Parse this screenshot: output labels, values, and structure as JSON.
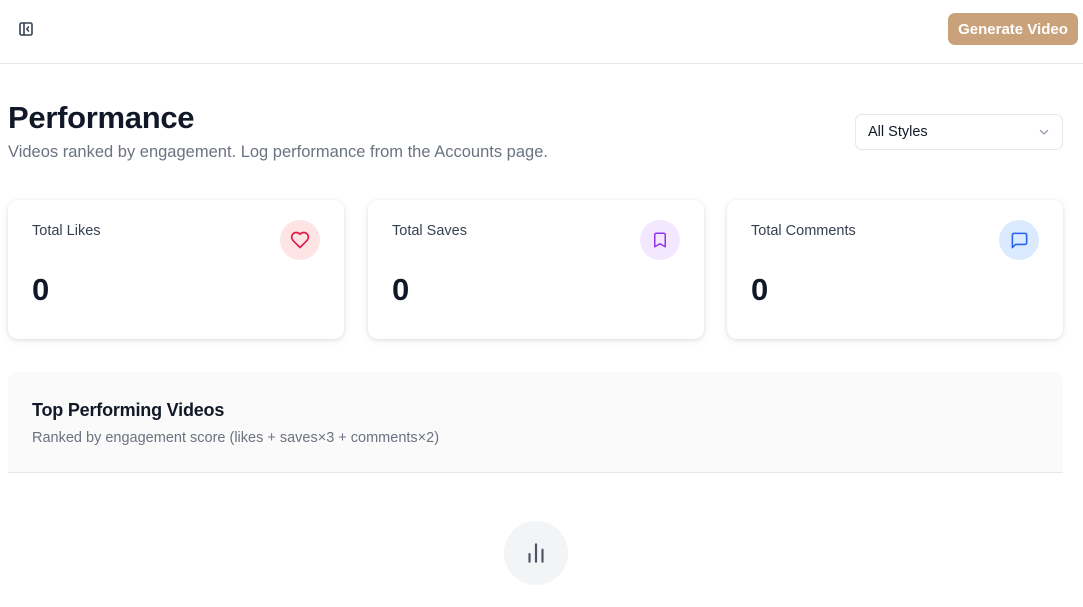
{
  "header": {
    "generate_button": "Generate Video",
    "sidebar_toggle_icon": "panel-left-close-icon"
  },
  "page": {
    "title": "Performance",
    "subtitle": "Videos ranked by engagement. Log performance from the Accounts page."
  },
  "filter": {
    "selected": "All Styles"
  },
  "stats": [
    {
      "label": "Total Likes",
      "value": "0",
      "icon": "heart-icon",
      "color": "#e11d48",
      "bg": "#ffe4e6"
    },
    {
      "label": "Total Saves",
      "value": "0",
      "icon": "bookmark-icon",
      "color": "#9333ea",
      "bg": "#f3e8ff"
    },
    {
      "label": "Total Comments",
      "value": "0",
      "icon": "message-square-icon",
      "color": "#2563eb",
      "bg": "#dbeafe"
    }
  ],
  "top_videos": {
    "title": "Top Performing Videos",
    "subtitle": "Ranked by engagement score (likes + saves×3 + comments×2)",
    "empty_icon": "bar-chart-icon"
  },
  "colors": {
    "accent": "#c9a27c"
  }
}
